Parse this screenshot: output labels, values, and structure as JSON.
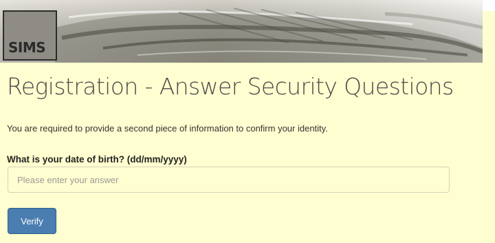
{
  "header": {
    "logo_text": "SIMS"
  },
  "main": {
    "title": "Registration - Answer Security Questions",
    "intro": "You are required to provide a second piece of information to confirm your identity.",
    "question_label": "What is your date of birth? (dd/mm/yyyy)",
    "answer_placeholder": "Please enter your answer",
    "answer_value": "",
    "verify_label": "Verify"
  },
  "colors": {
    "page_background": "#fffed0",
    "button_background": "#4a7eb0",
    "button_text": "#ffffff",
    "title_text": "#4a4a4a"
  }
}
